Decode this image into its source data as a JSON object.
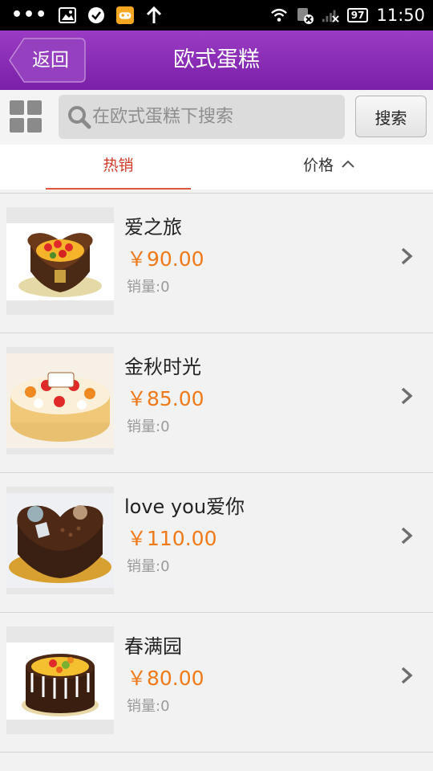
{
  "status_bar": {
    "time": "11:50",
    "battery": "97",
    "icons": [
      "more-dots-icon",
      "image-icon",
      "check-circle-icon",
      "gamepad-icon",
      "upload-arrow-icon",
      "wifi-icon",
      "sim-off-icon",
      "signal-icon",
      "battery-icon"
    ]
  },
  "nav": {
    "back_label": "返回",
    "title": "欧式蛋糕"
  },
  "search": {
    "placeholder": "在欧式蛋糕下搜索",
    "button_label": "搜索"
  },
  "tabs": {
    "hot": "热销",
    "price": "价格"
  },
  "products": [
    {
      "name": "爱之旅",
      "price": "￥90.00",
      "sales": "销量:0",
      "image": "heart-shaped-fruit-cake"
    },
    {
      "name": "金秋时光",
      "price": "￥85.00",
      "sales": "销量:0",
      "image": "round-fruit-birthday-cake"
    },
    {
      "name": "love you爱你",
      "price": "￥110.00",
      "sales": "销量:0",
      "image": "chocolate-heart-cake"
    },
    {
      "name": "春满园",
      "price": "￥80.00",
      "sales": "销量:0",
      "image": "chocolate-fruit-cake"
    }
  ],
  "colors": {
    "nav_purple": "#8a2cb8",
    "price_orange": "#f07a1a",
    "tab_active_red": "#d03a2a"
  }
}
